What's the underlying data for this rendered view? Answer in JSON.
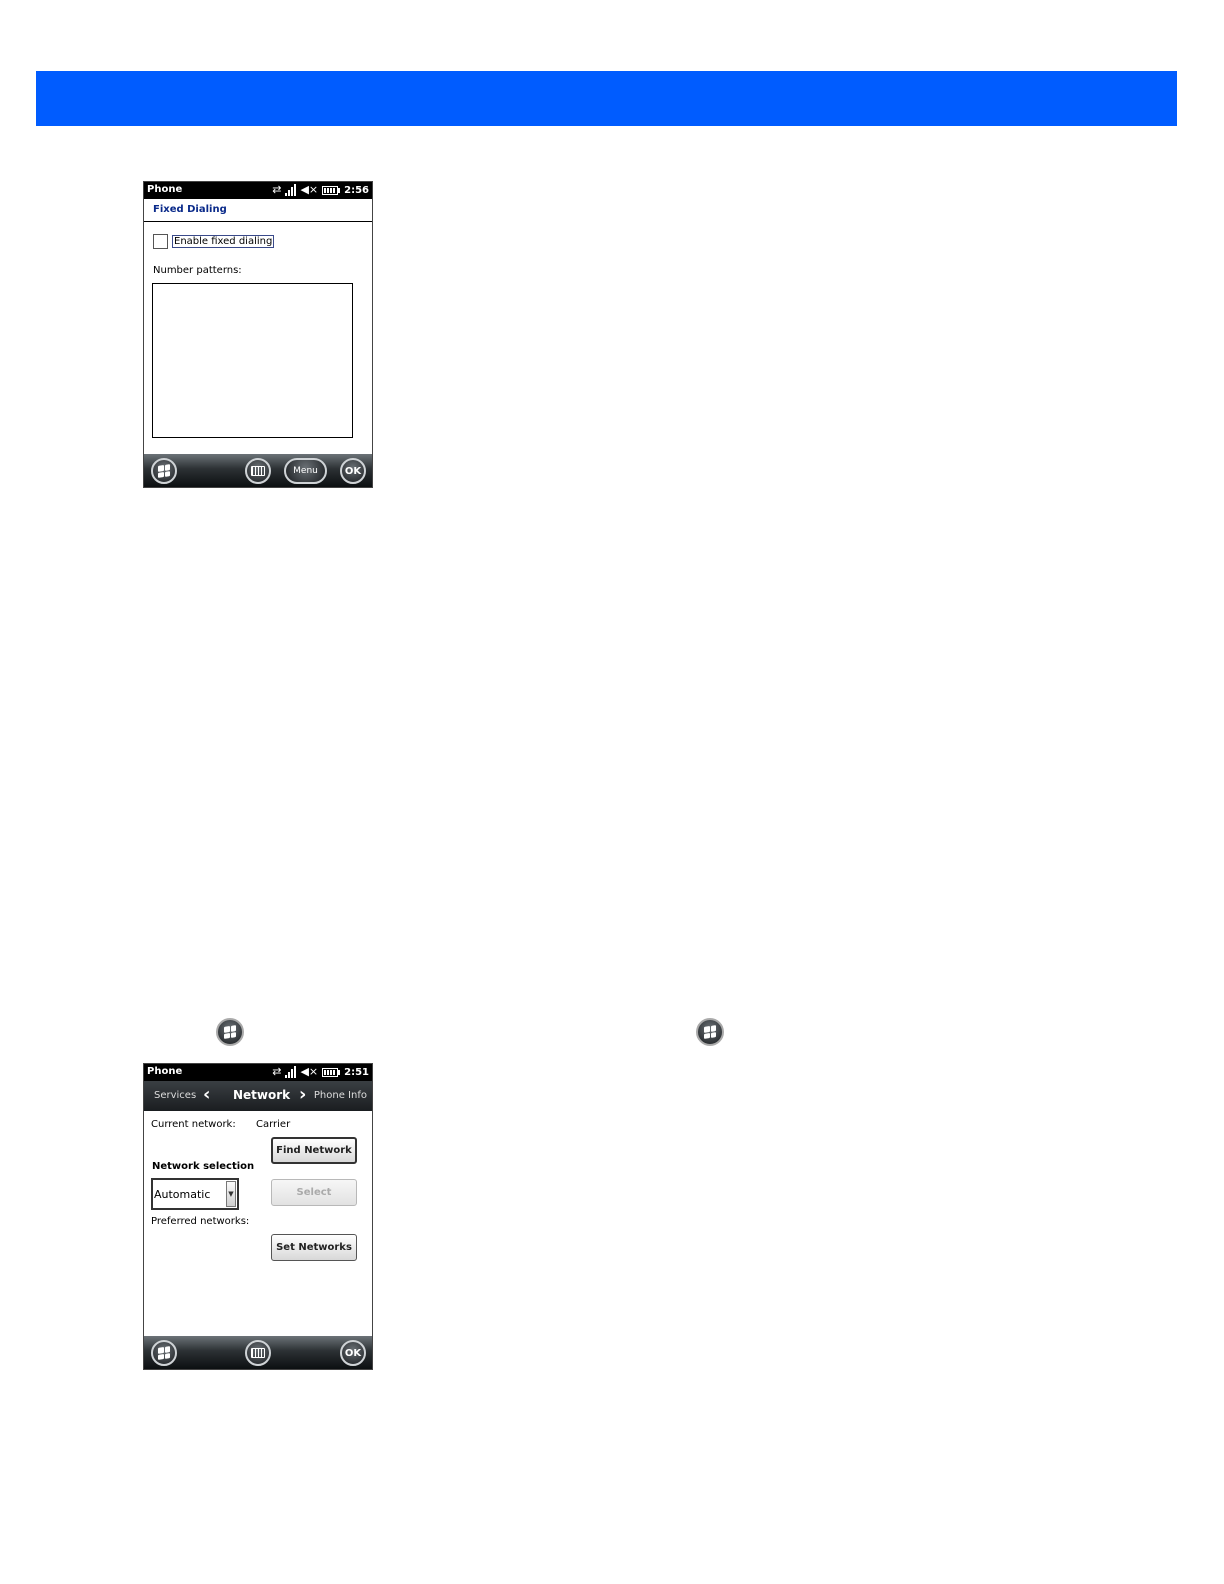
{
  "screen1": {
    "status": {
      "app": "Phone",
      "time": "2:56"
    },
    "title": "Fixed Dialing",
    "checkbox_label": "Enable fixed dialing",
    "checkbox_checked": false,
    "patterns_label": "Number patterns:",
    "patterns_value": "",
    "bottombar": {
      "menu": "Menu",
      "ok": "OK"
    }
  },
  "screen2": {
    "status": {
      "app": "Phone",
      "time": "2:51"
    },
    "tabs": {
      "prev": "Services",
      "current": "Network",
      "next": "Phone Info"
    },
    "current_network_label": "Current network:",
    "current_network_value": "Carrier",
    "find_network": "Find Network",
    "network_selection_label": "Network selection",
    "network_selection_value": "Automatic",
    "select": "Select",
    "preferred_networks_label": "Preferred networks:",
    "set_networks": "Set Networks",
    "bottombar": {
      "ok": "OK"
    }
  },
  "icons": {
    "start": "windows-start-icon",
    "keyboard": "keyboard-icon",
    "dropdown": "dropdown-arrow-icon"
  },
  "colors": {
    "banner": "#005cff",
    "title_text": "#0a2a8a"
  }
}
